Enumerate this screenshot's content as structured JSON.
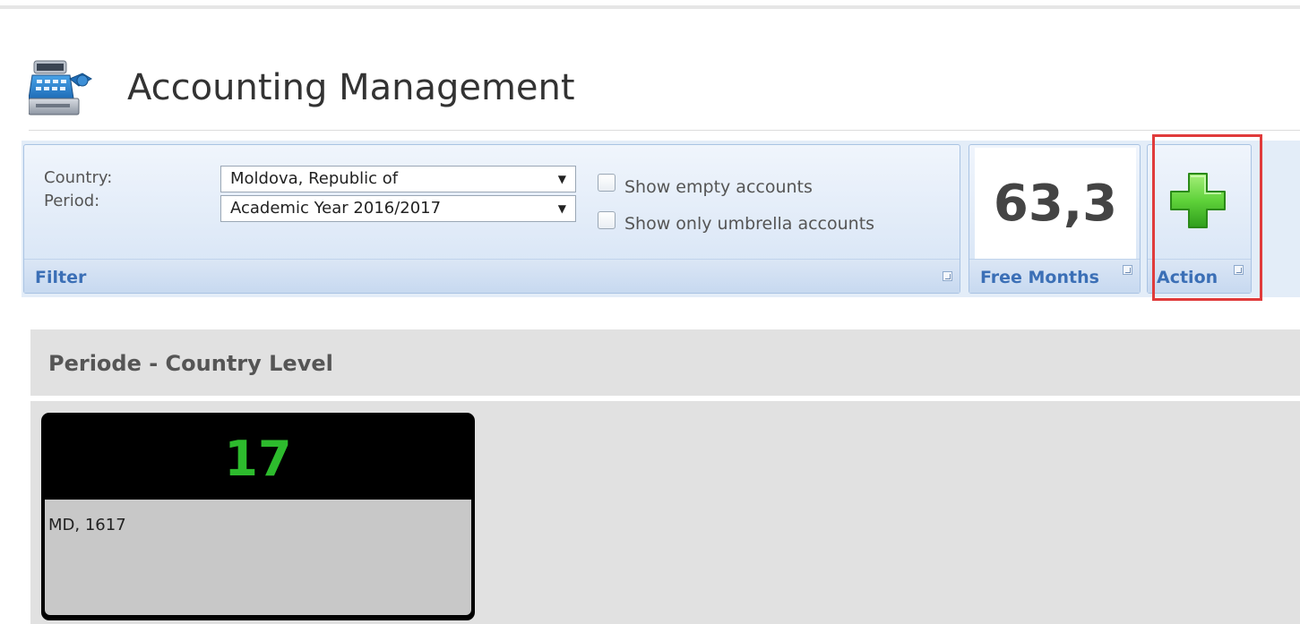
{
  "header": {
    "title": "Accounting Management",
    "icon": "cash-register-icon"
  },
  "ribbon": {
    "filter": {
      "country_label": "Country:",
      "country_value": "Moldova, Republic of",
      "period_label": "Period:",
      "period_value": "Academic Year 2016/2017",
      "show_empty_label": "Show empty accounts",
      "show_empty_checked": false,
      "show_umbrella_label": "Show only umbrella accounts",
      "show_umbrella_checked": false,
      "caption": "Filter"
    },
    "free_months": {
      "value": "63,3",
      "caption": "Free Months"
    },
    "action": {
      "icon": "plus-icon",
      "caption": "Action"
    }
  },
  "section": {
    "title": "Periode - Country Level",
    "tiles": [
      {
        "count": "17",
        "label": "MD, 1617"
      }
    ]
  },
  "colors": {
    "accent_blue": "#3b6fb6",
    "count_green": "#2dbb2d",
    "highlight_red": "#e03b3b"
  }
}
